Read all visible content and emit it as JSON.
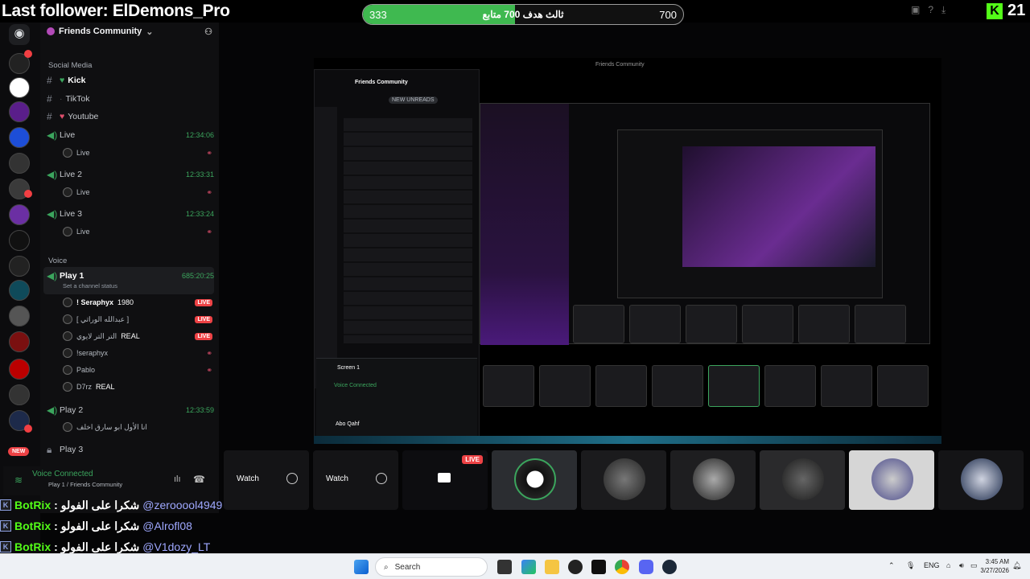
{
  "overlay": {
    "last_follower": "Last follower: ElDemons_Pro",
    "goal_current": "333",
    "goal_target": "700",
    "goal_label": "ثالث هدف 700 متابع",
    "goal_progress_fraction": 0.4757,
    "kick_count": "21"
  },
  "server": {
    "name": "Friends Community",
    "categories": {
      "social": "Social Media",
      "voice": "Voice"
    },
    "social_channels": [
      {
        "label": "Kick"
      },
      {
        "label": "TikTok"
      },
      {
        "label": "Youtube"
      }
    ],
    "live_channels": [
      {
        "label": "Live",
        "time": "12:34:06",
        "sub": "Live"
      },
      {
        "label": "Live 2",
        "time": "12:33:31",
        "sub": "Live"
      },
      {
        "label": "Live 3",
        "time": "12:33:24",
        "sub": "Live"
      }
    ],
    "play1": {
      "label": "Play 1",
      "time": "685:20:25",
      "status": "Set a channel status",
      "members": [
        {
          "name": "! Seraphyx",
          "tag": "1980",
          "live": "LIVE"
        },
        {
          "name": "[ عبدالله الوراثي ]",
          "tag": "",
          "live": "LIVE"
        },
        {
          "name": "التر التر لايوي",
          "tag": "REAL",
          "live": "LIVE"
        },
        {
          "name": "!seraphyx",
          "tag": "",
          "live": ""
        },
        {
          "name": "Pablo",
          "tag": "",
          "live": ""
        },
        {
          "name": "D7rz",
          "tag": "REAL",
          "live": ""
        }
      ]
    },
    "play2": {
      "label": "Play 2",
      "time": "12:33:59",
      "member": "انا الأول ابو سارق اخلف"
    },
    "play3": {
      "label": "Play 3"
    },
    "new_badge": "NEW"
  },
  "voice_status": {
    "title": "Voice Connected",
    "channel": "Play 1 / Friends Community"
  },
  "stream_tiles": {
    "watch1": "Watch",
    "watch2": "Watch",
    "live": "LIVE"
  },
  "inner_window": {
    "title": "Friends Community",
    "new_unreads": "NEW UNREADS",
    "voice_connected": "Voice Connected",
    "screen": "Screen 1",
    "user": "Abo Qahf"
  },
  "chat": [
    {
      "bot": "BotRix",
      "msg": "شكرا على الفولو",
      "user": "@zerooool4949"
    },
    {
      "bot": "BotRix",
      "msg": "شكرا على الفولو",
      "user": "@Alrofl08"
    },
    {
      "bot": "BotRix",
      "msg": "شكرا على الفولو",
      "user": "@V1dozy_LT"
    }
  ],
  "taskbar": {
    "search": "Search",
    "lang": "ENG",
    "time": "3:45 AM",
    "date": "3/27/2026"
  },
  "colors": {
    "discord_green": "#3ba55d",
    "live_red": "#ed4245",
    "kick_green": "#53fc18"
  }
}
